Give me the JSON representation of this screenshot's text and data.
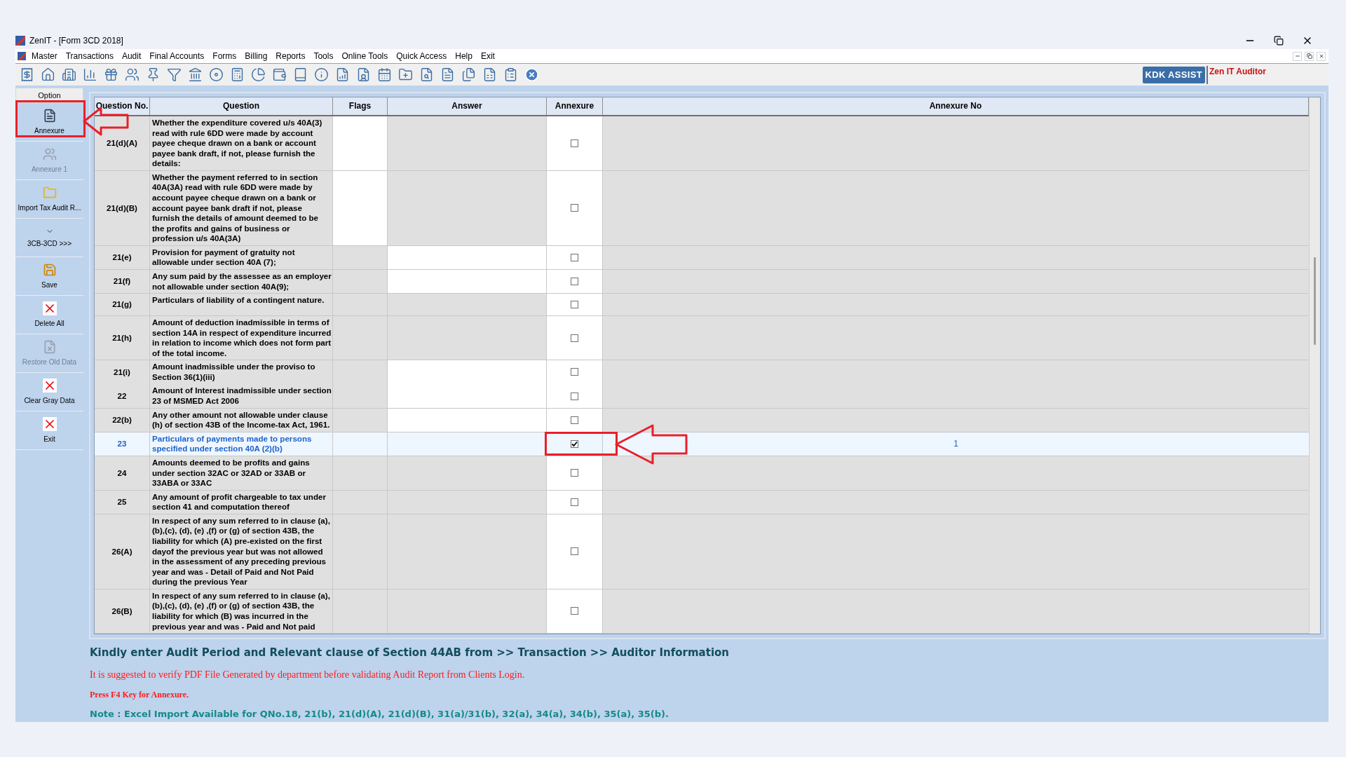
{
  "window": {
    "title": "ZenIT - [Form 3CD 2018]"
  },
  "menu": [
    "Master",
    "Transactions",
    "Audit",
    "Final Accounts",
    "Forms",
    "Billing",
    "Reports",
    "Tools",
    "Online Tools",
    "Quick Access",
    "Help",
    "Exit"
  ],
  "toolbar": {
    "assist_button": "KDK ASSIST",
    "product_label": "Zen IT Auditor"
  },
  "sidebar": {
    "header": "Option",
    "items": [
      {
        "label": "Annexure",
        "disabled": false
      },
      {
        "label": "Annexure 1",
        "disabled": true
      },
      {
        "label": "Import Tax Audit R...",
        "disabled": false
      },
      {
        "label": "3CB-3CD >>>",
        "disabled": false
      },
      {
        "label": "Save",
        "disabled": false
      },
      {
        "label": "Delete All",
        "disabled": false
      },
      {
        "label": "Restore Old Data",
        "disabled": true
      },
      {
        "label": "Clear Gray Data",
        "disabled": false
      },
      {
        "label": "Exit",
        "disabled": false
      }
    ]
  },
  "table": {
    "columns": [
      "Question No.",
      "Question",
      "Flags",
      "Answer",
      "Annexure",
      "Annexure No"
    ],
    "rows": [
      {
        "qno": "21(d)(A)",
        "question": "Whether the expenditure covered u/s 40A(3) read with rule 6DD were made by account payee cheque drawn on a bank or account payee bank draft, if not, please furnish the details:",
        "flags_editable": true,
        "answer_editable": false,
        "annexure": false,
        "selected": false
      },
      {
        "qno": "21(d)(B)",
        "question": "Whether the payment referred to in section 40A(3A) read with rule 6DD were made by account payee cheque drawn on a bank or account payee bank draft if not, please furnish the details of amount deemed to be the profits and gains of business or profession u/s 40A(3A)",
        "flags_editable": true,
        "answer_editable": false,
        "annexure": false,
        "selected": false
      },
      {
        "qno": "21(e)",
        "question": "Provision for payment of gratuity not allowable  under section 40A (7);",
        "flags_editable": false,
        "answer_editable": true,
        "annexure": false,
        "selected": false
      },
      {
        "qno": "21(f)",
        "question": "Any sum paid by the assessee as an employer not allowable under section 40A(9);",
        "flags_editable": false,
        "answer_editable": true,
        "annexure": false,
        "selected": false
      },
      {
        "qno": "21(g)",
        "question": "Particulars of liability of a contingent nature.",
        "flags_editable": false,
        "answer_editable": false,
        "annexure": false,
        "selected": false
      },
      {
        "qno": "21(h)",
        "question": "Amount of deduction inadmissible in terms of section 14A in respect of expenditure incurred in relation to income which does not form part of the total income.",
        "flags_editable": false,
        "answer_editable": false,
        "annexure": false,
        "selected": false
      },
      {
        "qno": "21(i)",
        "question": "Amount inadmissible under the proviso to Section 36(1)(iii)",
        "flags_editable": false,
        "answer_editable": true,
        "annexure": false,
        "selected": false
      },
      {
        "qno": "22",
        "question": "Amount of Interest inadmissible under section 23 of MSMED Act 2006",
        "flags_editable": false,
        "answer_editable": true,
        "annexure": false,
        "selected": false
      },
      {
        "qno": "22(b)",
        "question": "Any other amount not allowable under clause (h) of section 43B of the Income-tax Act, 1961.",
        "flags_editable": false,
        "answer_editable": true,
        "annexure": false,
        "selected": false
      },
      {
        "qno": "23",
        "question": "Particulars of payments made to persons specified under section 40A (2)(b)",
        "flags_editable": false,
        "answer_editable": false,
        "annexure": true,
        "annexure_no": "1",
        "selected": true
      },
      {
        "qno": "24",
        "question": "Amounts deemed to be profits and gains under section 32AC or 32AD or 33AB or 33ABA or 33AC",
        "flags_editable": false,
        "answer_editable": false,
        "annexure": false,
        "selected": false
      },
      {
        "qno": "25",
        "question": "Any amount of profit chargeable to tax under section 41 and computation thereof",
        "flags_editable": false,
        "answer_editable": false,
        "annexure": false,
        "selected": false
      },
      {
        "qno": "26(A)",
        "question": "In respect of any sum referred to in clause (a),(b),(c), (d), (e) ,(f) or (g) of section 43B, the liability for which (A) pre-existed on the first dayof the previous year but was not allowed in the assessment of any preceding previous year and was - Detail of Paid and Not Paid during the previous Year",
        "flags_editable": false,
        "answer_editable": false,
        "annexure": false,
        "selected": false
      },
      {
        "qno": "26(B)",
        "question": "In respect of any sum referred to in clause (a),(b),(c), (d), (e) ,(f) or (g) of section 43B, the liability for which (B) was incurred in the previous year and was - Paid and Not paid",
        "flags_editable": false,
        "answer_editable": false,
        "annexure": false,
        "selected": false
      }
    ]
  },
  "messages": [
    {
      "kind": "heading",
      "text": "Kindly enter Audit Period and Relevant clause of Section 44AB from >> Transaction >> Auditor Information"
    },
    {
      "kind": "warning",
      "text": "It is suggested to verify PDF File Generated by department before validating Audit Report from Clients Login."
    },
    {
      "kind": "hint",
      "text": "Press F4 Key for Annexure."
    },
    {
      "kind": "note",
      "text": "Note : Excel Import Available for QNo.18, 21(b), 21(d)(A), 21(d)(B), 31(a)/31(b), 32(a), 34(a), 34(b), 35(a), 35(b)."
    }
  ]
}
